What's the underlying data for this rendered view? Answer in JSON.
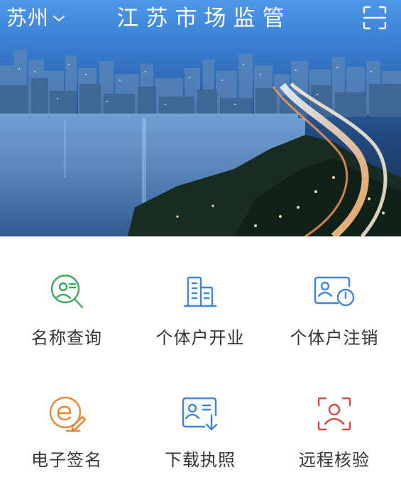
{
  "header": {
    "city": "苏州",
    "title": "江苏市场监管"
  },
  "colors": {
    "green": "#3aaa59",
    "blue": "#3f86d6",
    "orange": "#e98533",
    "red": "#d9463c",
    "label": "#333333"
  },
  "services": [
    {
      "label": "名称查询",
      "icon": "name-search-icon"
    },
    {
      "label": "个体户开业",
      "icon": "building-icon"
    },
    {
      "label": "个体户注销",
      "icon": "id-card-power-icon"
    },
    {
      "label": "电子签名",
      "icon": "e-sign-icon"
    },
    {
      "label": "下载执照",
      "icon": "license-download-icon"
    },
    {
      "label": "远程核验",
      "icon": "face-verify-icon"
    }
  ]
}
